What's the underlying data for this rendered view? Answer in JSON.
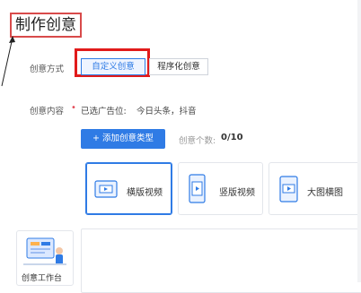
{
  "header": {
    "title": "制作创意"
  },
  "creative_mode": {
    "label": "创意方式",
    "options": [
      {
        "label": "自定义创意",
        "selected": true
      },
      {
        "label": "程序化创意",
        "selected": false
      }
    ]
  },
  "creative_content": {
    "label": "创意内容",
    "required_mark": "•",
    "placement_prefix": "已选广告位:",
    "placement_value": "今日头条，抖音"
  },
  "add_type": {
    "button_label": "+ 添加创意类型",
    "count_label": "创意个数:",
    "count_value": "0/10"
  },
  "types": [
    {
      "label": "横版视频",
      "icon": "horizontal-video-icon",
      "selected": true
    },
    {
      "label": "竖版视频",
      "icon": "vertical-video-icon",
      "selected": false
    },
    {
      "label": "大图横图",
      "icon": "large-image-icon",
      "selected": false
    }
  ],
  "workbench": {
    "label": "创意工作台"
  },
  "colors": {
    "accent": "#2f7be5",
    "highlight": "#e11b1b",
    "required": "#e34d59"
  }
}
